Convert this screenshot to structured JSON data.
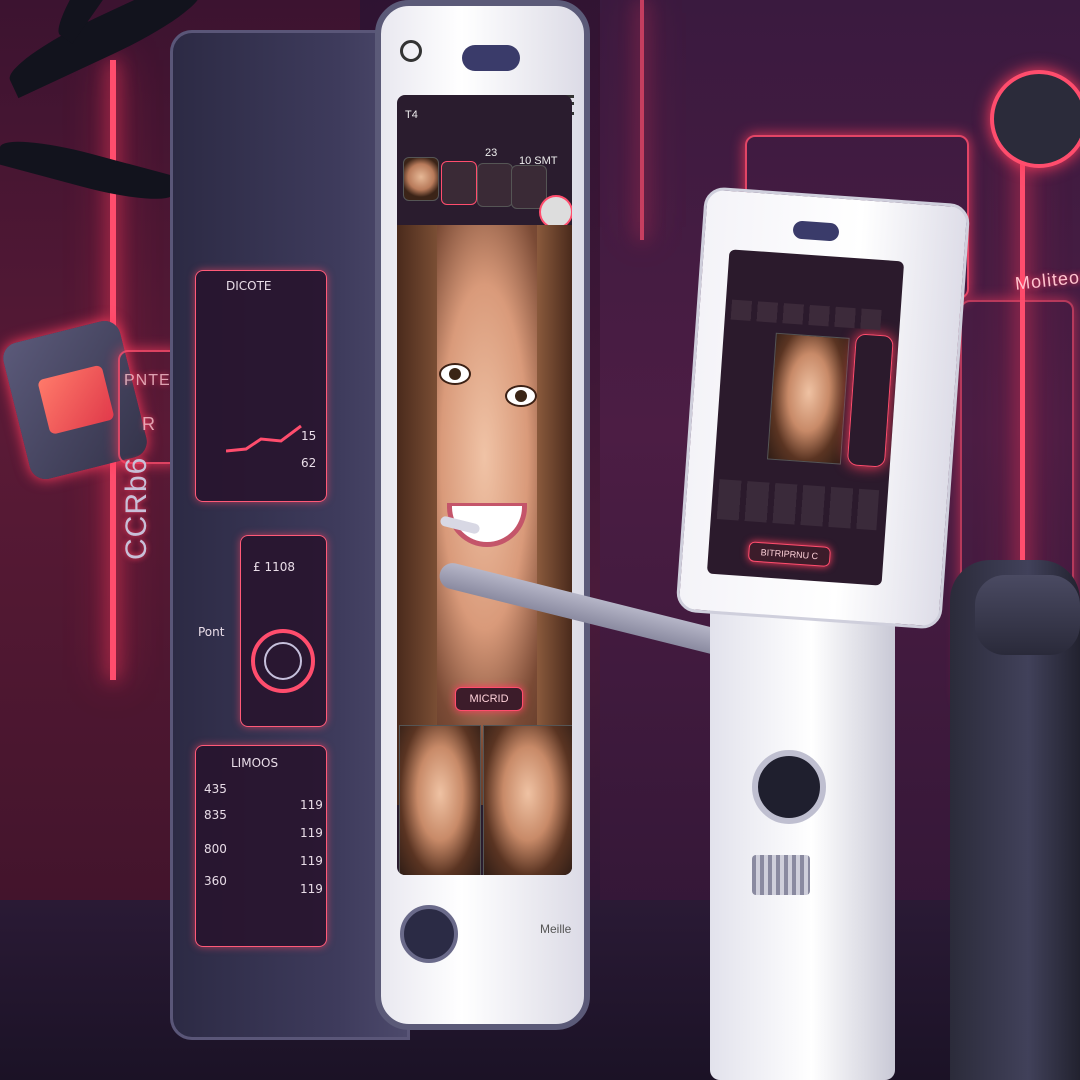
{
  "scene": {
    "description_colors": {
      "neon": "#ff4d6d",
      "wall": "#4a1b3a",
      "device_white": "#ffffff",
      "screen_dark": "#2a1c2e"
    }
  },
  "left_wall": {
    "sign_top": "PNTE",
    "sign_letter": "R",
    "vertical_text": "CCRb6"
  },
  "cabinet": {
    "panel_header_1": "DICOTE",
    "values_right": [
      "15",
      "62"
    ],
    "mid_label": "£ 1108",
    "side_label": "Pont",
    "bottom_header": "LIMOOS",
    "bottom_values": [
      "435",
      "835",
      "800",
      "360"
    ],
    "bottom_right_values": [
      "119",
      "119",
      "119",
      "119"
    ]
  },
  "big_phone": {
    "status_left": "T4",
    "status_mid": "23",
    "status_right": "10 SMT",
    "highlight_pill": "MICRID",
    "footer_text": "Meille"
  },
  "robot_phone": {
    "pill": "BITRIPRNU C"
  },
  "right_wall": {
    "sign": "Moliteor"
  }
}
